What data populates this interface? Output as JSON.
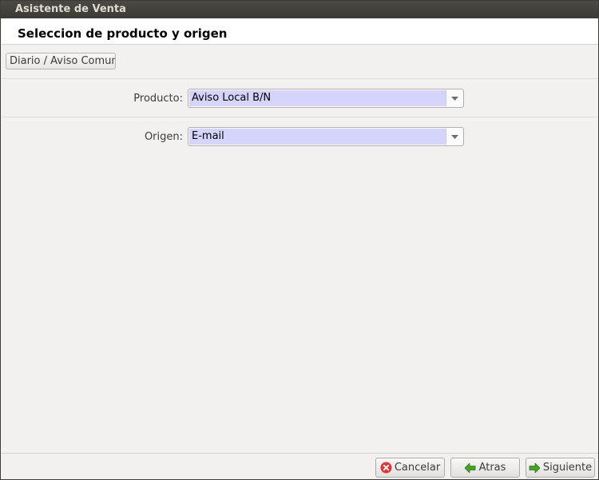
{
  "window": {
    "title": "Asistente de Venta"
  },
  "header": {
    "title": "Seleccion de producto y origen"
  },
  "tab": {
    "label": "Diario / Aviso Comun"
  },
  "form": {
    "producto": {
      "label": "Producto:",
      "value": "Aviso Local B/N"
    },
    "origen": {
      "label": "Origen:",
      "value": "E-mail"
    }
  },
  "footer": {
    "cancel_label": "Cancelar",
    "back_label": "Atras",
    "next_label": "Siguiente"
  },
  "colors": {
    "selection": "#d4d4fd",
    "cancel_icon": "#d93a3a",
    "arrow_icon": "#4aa12a"
  },
  "icons": {
    "cancel": "cancel-icon",
    "back": "arrow-left-icon",
    "next": "arrow-right-icon",
    "dropdown": "chevron-down-icon"
  }
}
